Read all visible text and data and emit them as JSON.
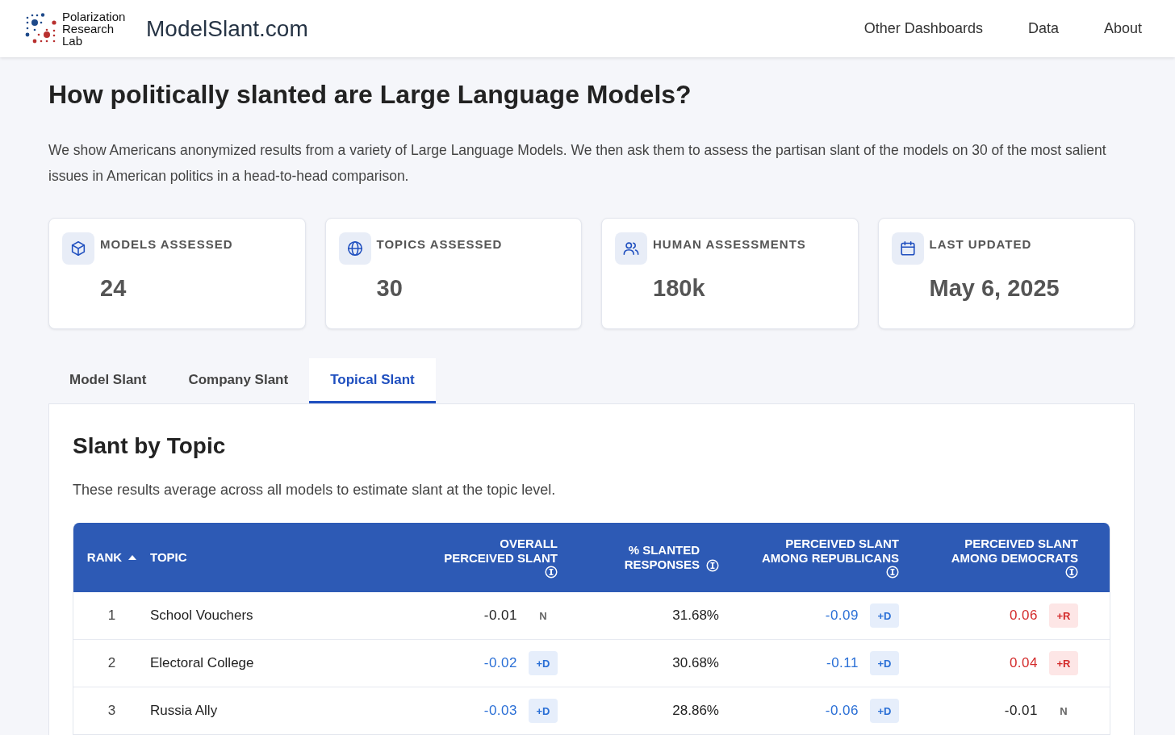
{
  "header": {
    "lab_name": "Polarization Research Lab",
    "site_title": "ModelSlant.com",
    "nav": [
      {
        "label": "Other Dashboards"
      },
      {
        "label": "Data"
      },
      {
        "label": "About"
      }
    ]
  },
  "title": "How politically slanted are Large Language Models?",
  "intro": "We show Americans anonymized results from a variety of Large Language Models. We then ask them to assess the partisan slant of the models on 30 of the most salient issues in American politics in a head-to-head comparison.",
  "stats": [
    {
      "kind": "cube",
      "label": "MODELS ASSESSED",
      "value": "24"
    },
    {
      "kind": "globe",
      "label": "TOPICS ASSESSED",
      "value": "30"
    },
    {
      "kind": "users",
      "label": "HUMAN ASSESSMENTS",
      "value": "180k"
    },
    {
      "kind": "calendar",
      "label": "LAST UPDATED",
      "value": "May 6, 2025"
    }
  ],
  "tabs": [
    {
      "label": "Model Slant",
      "selected": false
    },
    {
      "label": "Company Slant",
      "selected": false
    },
    {
      "label": "Topical Slant",
      "selected": true
    }
  ],
  "panel": {
    "title": "Slant by Topic",
    "description": "These results average across all models to estimate slant at the topic level.",
    "table": {
      "columns": [
        {
          "label": "RANK",
          "sorted": true,
          "info": false
        },
        {
          "label": "TOPIC",
          "sorted": false,
          "info": false
        },
        {
          "label": "OVERALL PERCEIVED SLANT",
          "sorted": false,
          "info": true
        },
        {
          "label": "% SLANTED RESPONSES",
          "sorted": false,
          "info": true
        },
        {
          "label": "PERCEIVED SLANT AMONG REPUBLICANS",
          "sorted": false,
          "info": true
        },
        {
          "label": "PERCEIVED SLANT AMONG DEMOCRATS",
          "sorted": false,
          "info": true
        }
      ],
      "rows": [
        {
          "rank": "1",
          "topic": "School Vouchers",
          "overall": {
            "value": "-0.01",
            "tag": "N",
            "kind": "neutral"
          },
          "slanted": "31.68%",
          "republicans": {
            "value": "-0.09",
            "tag": "+D",
            "kind": "dem"
          },
          "democrats": {
            "value": "0.06",
            "tag": "+R",
            "kind": "rep"
          }
        },
        {
          "rank": "2",
          "topic": "Electoral College",
          "overall": {
            "value": "-0.02",
            "tag": "+D",
            "kind": "dem"
          },
          "slanted": "30.68%",
          "republicans": {
            "value": "-0.11",
            "tag": "+D",
            "kind": "dem"
          },
          "democrats": {
            "value": "0.04",
            "tag": "+R",
            "kind": "rep"
          }
        },
        {
          "rank": "3",
          "topic": "Russia Ally",
          "overall": {
            "value": "-0.03",
            "tag": "+D",
            "kind": "dem"
          },
          "slanted": "28.86%",
          "republicans": {
            "value": "-0.06",
            "tag": "+D",
            "kind": "dem"
          },
          "democrats": {
            "value": "-0.01",
            "tag": "N",
            "kind": "neutral"
          }
        }
      ]
    }
  }
}
